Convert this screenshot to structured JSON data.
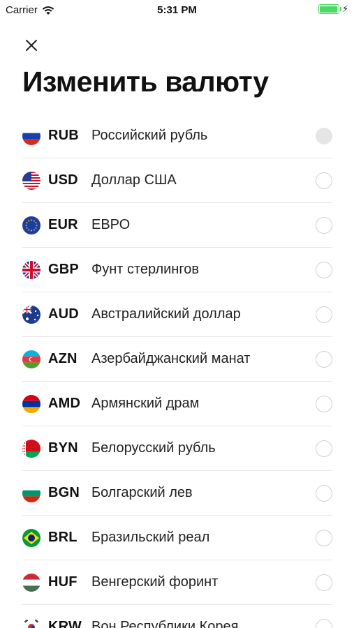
{
  "status_bar": {
    "carrier": "Carrier",
    "time": "5:31 PM",
    "battery_color": "#4cd964"
  },
  "header": {
    "close_icon": "close-icon",
    "title": "Изменить валюту"
  },
  "currencies": [
    {
      "code": "RUB",
      "name": "Российский рубль",
      "selected": true,
      "flag": "russia-flag-icon"
    },
    {
      "code": "USD",
      "name": "Доллар США",
      "selected": false,
      "flag": "usa-flag-icon"
    },
    {
      "code": "EUR",
      "name": "ЕВРО",
      "selected": false,
      "flag": "eu-flag-icon"
    },
    {
      "code": "GBP",
      "name": "Фунт стерлингов",
      "selected": false,
      "flag": "uk-flag-icon"
    },
    {
      "code": "AUD",
      "name": "Австралийский доллар",
      "selected": false,
      "flag": "australia-flag-icon"
    },
    {
      "code": "AZN",
      "name": "Азербайджанский манат",
      "selected": false,
      "flag": "azerbaijan-flag-icon"
    },
    {
      "code": "AMD",
      "name": "Армянский драм",
      "selected": false,
      "flag": "armenia-flag-icon"
    },
    {
      "code": "BYN",
      "name": "Белорусский рубль",
      "selected": false,
      "flag": "belarus-flag-icon"
    },
    {
      "code": "BGN",
      "name": "Болгарский лев",
      "selected": false,
      "flag": "bulgaria-flag-icon"
    },
    {
      "code": "BRL",
      "name": "Бразильский реал",
      "selected": false,
      "flag": "brazil-flag-icon"
    },
    {
      "code": "HUF",
      "name": "Венгерский форинт",
      "selected": false,
      "flag": "hungary-flag-icon"
    },
    {
      "code": "KRW",
      "name": "Вон Республики Корея",
      "selected": false,
      "flag": "south-korea-flag-icon"
    }
  ]
}
